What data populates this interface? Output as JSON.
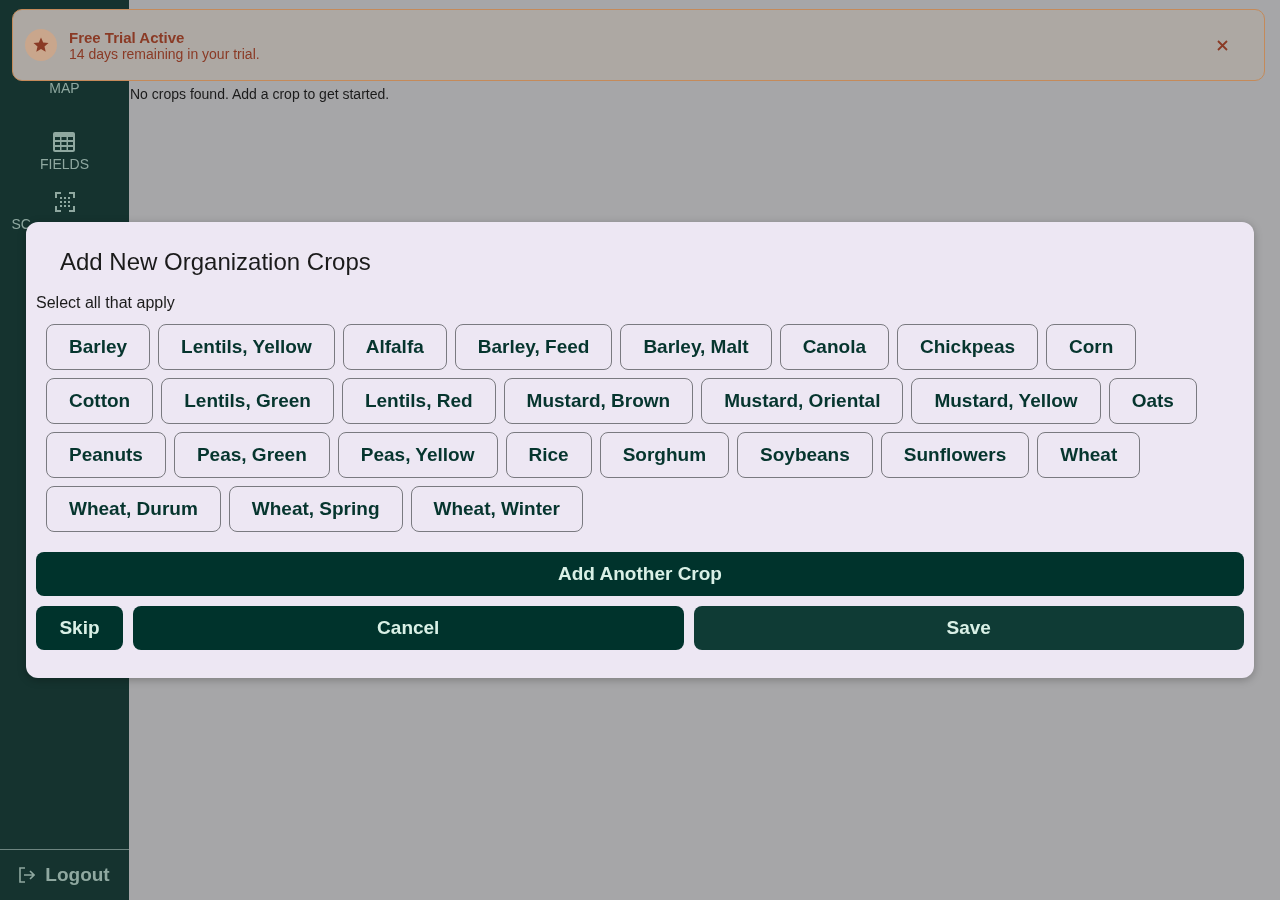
{
  "sidebar": {
    "items": [
      {
        "label": "MAP",
        "kind": "plain"
      },
      {
        "label": "FIELDS",
        "kind": "grid"
      },
      {
        "label": "SC",
        "kind": "scan"
      }
    ],
    "logout": "Logout"
  },
  "main": {
    "empty_message": "No crops found. Add a crop to get started."
  },
  "banner": {
    "title": "Free Trial Active",
    "message": "14 days remaining in your trial."
  },
  "dialog": {
    "title": "Add New Organization Crops",
    "instruction": "Select all that apply",
    "crops": [
      {
        "label": "Barley",
        "selected": false
      },
      {
        "label": "Lentils, Yellow",
        "selected": false
      },
      {
        "label": "Alfalfa",
        "selected": false
      },
      {
        "label": "Barley, Feed",
        "selected": false
      },
      {
        "label": "Barley, Malt",
        "selected": false
      },
      {
        "label": "Canola",
        "selected": false
      },
      {
        "label": "Chickpeas",
        "selected": false
      },
      {
        "label": "Corn",
        "selected": false
      },
      {
        "label": "Cotton",
        "selected": false
      },
      {
        "label": "Lentils, Green",
        "selected": false
      },
      {
        "label": "Lentils, Red",
        "selected": false
      },
      {
        "label": "Mustard, Brown",
        "selected": false
      },
      {
        "label": "Mustard, Oriental",
        "selected": false
      },
      {
        "label": "Mustard, Yellow",
        "selected": false
      },
      {
        "label": "Oats",
        "selected": false
      },
      {
        "label": "Peanuts",
        "selected": false
      },
      {
        "label": "Peas, Green",
        "selected": false
      },
      {
        "label": "Peas, Yellow",
        "selected": false
      },
      {
        "label": "Rice",
        "selected": false
      },
      {
        "label": "Sorghum",
        "selected": false
      },
      {
        "label": "Soybeans",
        "selected": false
      },
      {
        "label": "Sunflowers",
        "selected": false
      },
      {
        "label": "Wheat",
        "selected": false
      },
      {
        "label": "Wheat, Durum",
        "selected": false
      },
      {
        "label": "Wheat, Spring",
        "selected": false
      },
      {
        "label": "Wheat, Winter",
        "selected": false
      }
    ],
    "add_button": "Add Another Crop",
    "buttons": [
      {
        "label": "Skip",
        "kind": "skip"
      },
      {
        "label": "Cancel",
        "kind": "cancel"
      },
      {
        "label": "Save",
        "kind": "save"
      }
    ]
  }
}
